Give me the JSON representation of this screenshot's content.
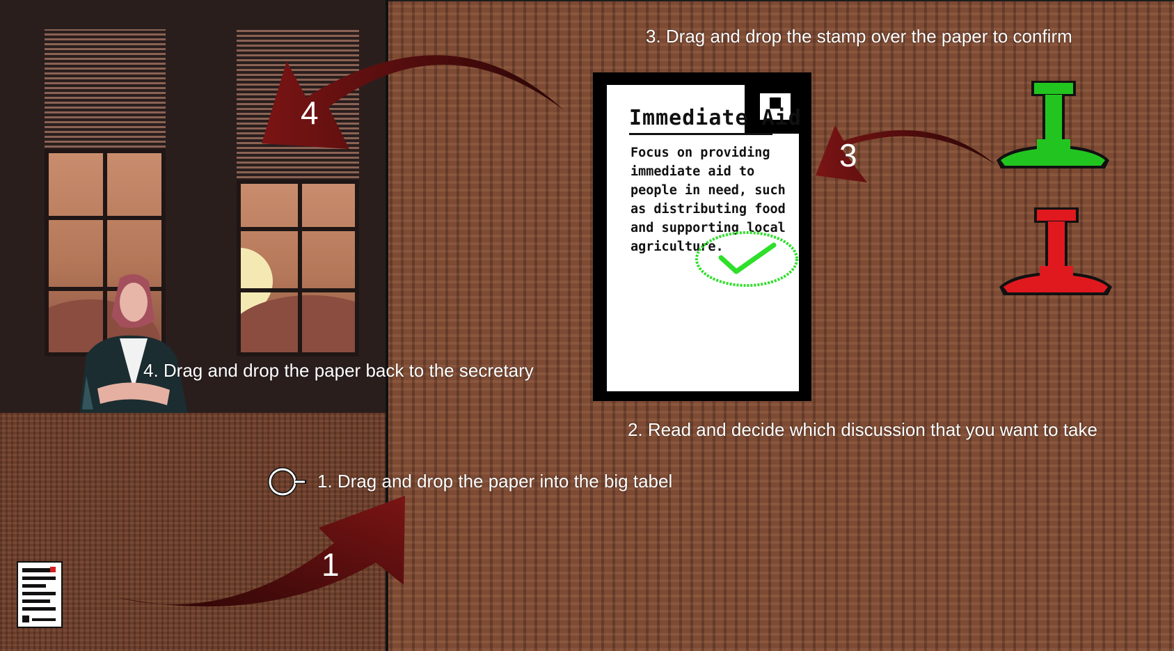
{
  "instructions": {
    "step1": "1. Drag and drop the paper into the big tabel",
    "step2": "2. Read and decide which discussion that you want to take",
    "step3": "3. Drag and drop the stamp over the paper to confirm",
    "step4": "4. Drag and drop the paper back to the secretary"
  },
  "arrow_numbers": {
    "one": "1",
    "three": "3",
    "four": "4"
  },
  "document": {
    "title": "Immediate Aid",
    "body": "Focus on providing immediate aid to people in need, such as distributing food and supporting local agriculture.",
    "stamp_mark": "check-approved"
  },
  "stamps": {
    "approve_color": "#22c51f",
    "reject_color": "#e0191f"
  },
  "colors": {
    "table": "#7d4a33",
    "arrow": "#5c0f0f",
    "text": "#ffffff"
  }
}
